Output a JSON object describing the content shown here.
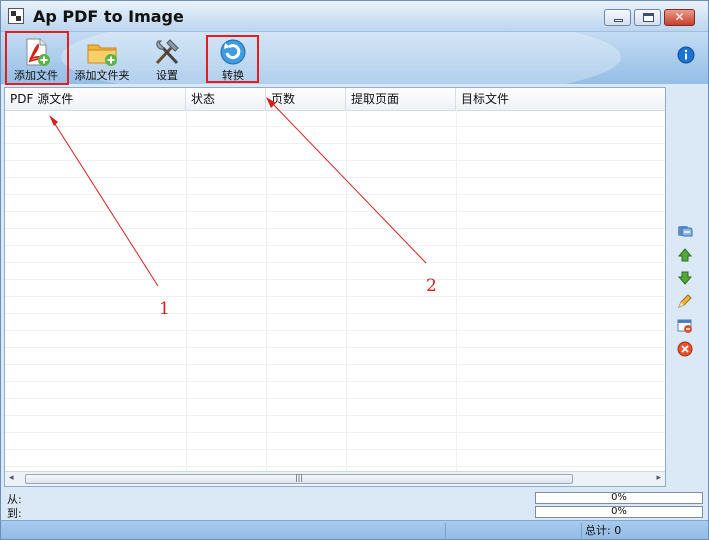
{
  "window": {
    "title": "Ap PDF to Image",
    "close_glyph": "✕"
  },
  "toolbar": {
    "add_file": "添加文件",
    "add_folder": "添加文件夹",
    "settings": "设置",
    "convert": "转换"
  },
  "grid": {
    "columns": [
      "PDF 源文件",
      "状态",
      "页数",
      "提取页面",
      "目标文件"
    ],
    "rows": []
  },
  "progress": {
    "from_label": "从:",
    "to_label": "到:",
    "from_value": "0%",
    "to_value": "0%"
  },
  "statusbar": {
    "total": "总计: 0"
  },
  "annotations": {
    "label1": "1",
    "label2": "2",
    "color": "#d62020"
  },
  "icons": {
    "info": "info-icon",
    "sidebar": [
      "refresh-icon",
      "move-up-icon",
      "move-down-icon",
      "edit-icon",
      "remove-icon",
      "clear-icon"
    ]
  }
}
